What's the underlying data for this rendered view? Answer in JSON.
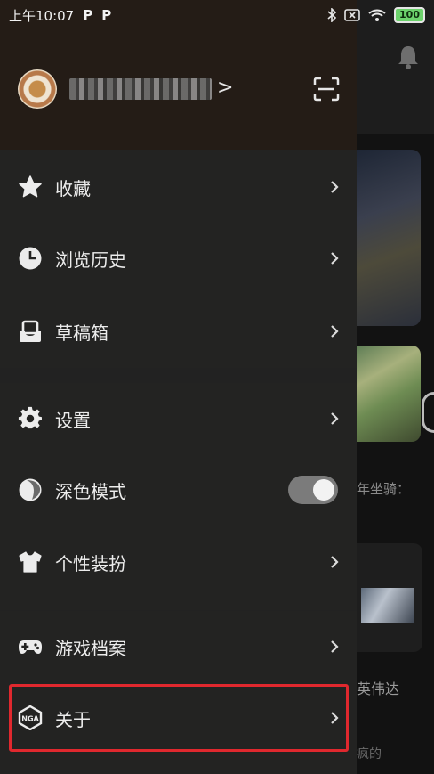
{
  "status_bar": {
    "time": "上午10:07",
    "app_icon_1": "P",
    "app_icon_2": "P",
    "battery": "100",
    "icons": [
      "bluetooth-icon",
      "sim-x-icon",
      "wifi-icon",
      "battery-icon"
    ]
  },
  "drawer": {
    "user_arrow": ">",
    "groups": [
      {
        "items": [
          {
            "label": "收藏",
            "icon": "star-icon"
          },
          {
            "label": "浏览历史",
            "icon": "clock-icon"
          },
          {
            "label": "草稿箱",
            "icon": "inbox-icon"
          }
        ]
      },
      {
        "items": [
          {
            "label": "设置",
            "icon": "gear-icon"
          },
          {
            "label": "深色模式",
            "icon": "moon-icon",
            "toggle": true
          },
          {
            "label": "个性装扮",
            "icon": "shirt-icon"
          }
        ]
      },
      {
        "items": [
          {
            "label": "游戏档案",
            "icon": "gamepad-icon"
          },
          {
            "label": "关于",
            "icon": "nga-logo-icon",
            "highlighted": true
          }
        ]
      }
    ],
    "nga_logo_text": "NGA"
  },
  "background": {
    "text_1": "年坐骑：",
    "text_2": "英伟达",
    "text_3": "疯的"
  },
  "colors": {
    "highlight_border": "#e0282e",
    "drawer_bg": "#232322",
    "header_bg": "#241c16",
    "toggle_track": "#7b7b7b"
  }
}
